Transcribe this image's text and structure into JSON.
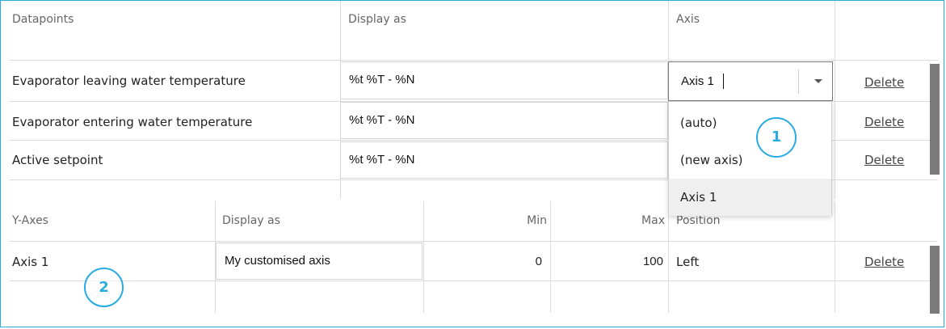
{
  "datapoints": {
    "headers": {
      "name": "Datapoints",
      "display_as": "Display as",
      "axis": "Axis"
    },
    "rows": [
      {
        "name": "Evaporator leaving water temperature",
        "display_as": "%t %T - %N",
        "axis": "Axis 1",
        "delete": "Delete"
      },
      {
        "name": "Evaporator entering water temperature",
        "display_as": "%t %T - %N",
        "delete": "Delete"
      },
      {
        "name": "Active setpoint",
        "display_as": "%t %T - %N",
        "delete": "Delete"
      }
    ],
    "axis_dropdown": {
      "options": [
        "(auto)",
        "(new axis)",
        "Axis 1"
      ],
      "selected": "Axis 1"
    }
  },
  "yaxes": {
    "headers": {
      "name": "Y-Axes",
      "display_as": "Display as",
      "min": "Min",
      "max": "Max",
      "position": "Position"
    },
    "rows": [
      {
        "name": "Axis 1",
        "display_as": "My customised axis",
        "min": "0",
        "max": "100",
        "position": "Left",
        "delete": "Delete"
      }
    ]
  },
  "callouts": {
    "one": "1",
    "two": "2"
  },
  "colors": {
    "accent": "#29abe2",
    "scrollbar": "#7a7a7a",
    "selected_option": "#efefef"
  }
}
